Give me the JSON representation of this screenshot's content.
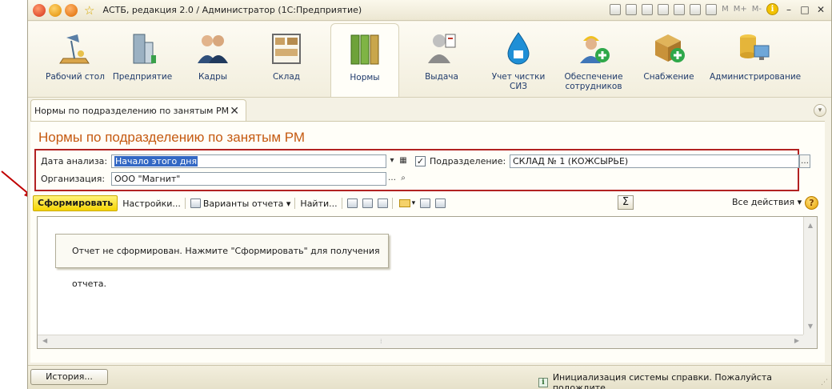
{
  "window": {
    "title": "АСТБ, редакция 2.0 / Администратор  (1С:Предприятие)",
    "toolbar_text": {
      "m": "M",
      "m_plus": "M+",
      "m_minus": "M-"
    }
  },
  "sections": [
    {
      "label": "Рабочий стол",
      "icon": "desk-lamp-icon"
    },
    {
      "label": "Предприятие",
      "icon": "building-icon"
    },
    {
      "label": "Кадры",
      "icon": "people-icon"
    },
    {
      "label": "Склад",
      "icon": "warehouse-shelf-icon"
    },
    {
      "label": "Нормы",
      "icon": "binders-icon",
      "active": true
    },
    {
      "label": "Выдача",
      "icon": "worker-icon"
    },
    {
      "label": "Учет чистки СИЗ",
      "icon": "water-drop-icon"
    },
    {
      "label": "Обеспечение сотрудников",
      "icon": "worker-add-icon"
    },
    {
      "label": "Снабжение",
      "icon": "box-add-icon"
    },
    {
      "label": "Администрирование",
      "icon": "database-pc-icon"
    }
  ],
  "tab": {
    "label": "Нормы по подразделению по занятым РМ",
    "close": "✕"
  },
  "form": {
    "title": "Нормы по подразделению по занятым РМ",
    "params": {
      "date_label": "Дата анализа:",
      "date_value": "Начало этого дня",
      "division_label": "Подразделение:",
      "division_checked": true,
      "division_value": "СКЛАД № 1 (КОЖСЫРЬЕ)",
      "org_label": "Организация:",
      "org_value": "ООО \"Магнит\""
    },
    "commands": {
      "generate": "Сформировать",
      "settings": "Настройки...",
      "variants": "Варианты отчета",
      "find": "Найти...",
      "all_actions": "Все действия",
      "sigma": "Σ",
      "help": "?"
    },
    "report_notice": "Отчет не сформирован. Нажмите \"Сформировать\" для получения отчета."
  },
  "statusbar": {
    "history": "История...",
    "message": "Инициализация системы справки. Пожалуйста подождите..."
  },
  "colors": {
    "accent_title": "#c55a11",
    "generate_button": "#f5d400",
    "highlight_frame": "#b22222",
    "selection": "#3368c4"
  }
}
